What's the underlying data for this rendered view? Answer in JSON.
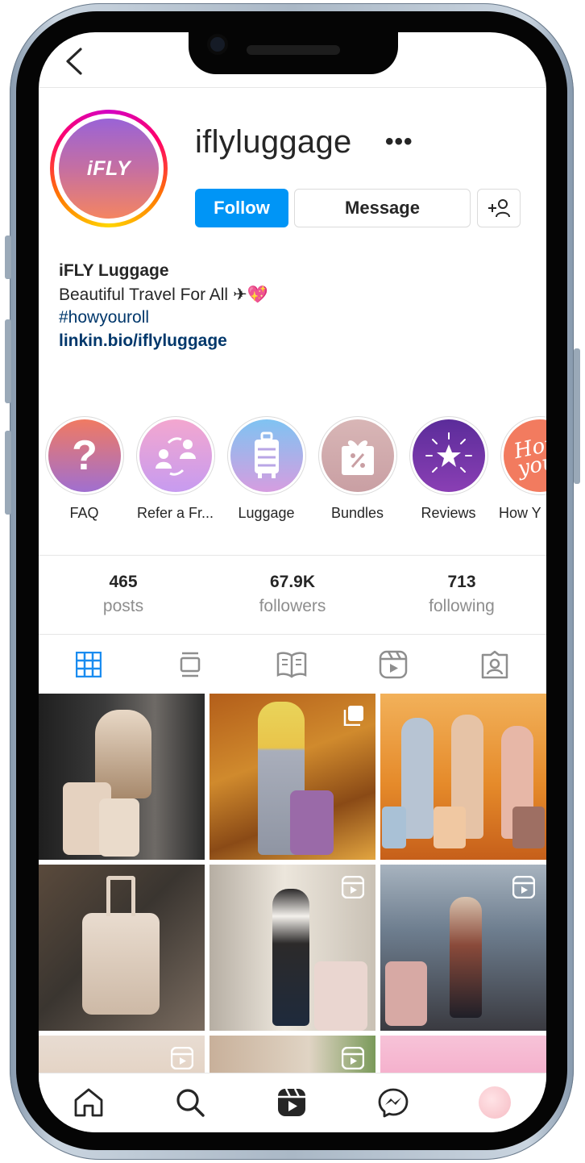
{
  "profile": {
    "username": "iflyluggage",
    "avatar_text": "iFLY",
    "more_label": "•••",
    "follow_label": "Follow",
    "message_label": "Message"
  },
  "bio": {
    "name": "iFLY Luggage",
    "line": "Beautiful Travel For All",
    "emoji": "✈💖",
    "hashtag": "#howyouroll",
    "link": "linkin.bio/iflyluggage"
  },
  "highlights": [
    {
      "label": "FAQ",
      "icon": "question-icon"
    },
    {
      "label": "Refer a Fr...",
      "icon": "refer-icon"
    },
    {
      "label": "Luggage",
      "icon": "suitcase-icon"
    },
    {
      "label": "Bundles",
      "icon": "gift-icon"
    },
    {
      "label": "Reviews",
      "icon": "star-icon"
    },
    {
      "label": "How Y",
      "icon": "script-text-icon"
    }
  ],
  "stats": {
    "posts_count": "465",
    "posts_label": "posts",
    "followers_count": "67.9K",
    "followers_label": "followers",
    "following_count": "713",
    "following_label": "following"
  },
  "tabs": [
    "grid-icon",
    "feed-icon",
    "guide-icon",
    "reels-icon",
    "tagged-icon"
  ],
  "grid": [
    {
      "kind": "photo",
      "badge": "none",
      "colors": [
        "#2b2b2b",
        "#6e6a66",
        "#e5d2c0"
      ]
    },
    {
      "kind": "photo",
      "badge": "carousel-icon",
      "colors": [
        "#c57a24",
        "#8a4a16",
        "#e9c44a"
      ]
    },
    {
      "kind": "photo",
      "badge": "none",
      "colors": [
        "#e58a2a",
        "#f2b15a",
        "#b7c4d3"
      ]
    },
    {
      "kind": "photo",
      "badge": "none",
      "colors": [
        "#3a3530",
        "#7a6c60",
        "#d8c7b8"
      ]
    },
    {
      "kind": "photo",
      "badge": "reels-icon",
      "colors": [
        "#c9c1b5",
        "#ece6dc",
        "#2c2a2a"
      ]
    },
    {
      "kind": "photo",
      "badge": "reels-icon",
      "colors": [
        "#6d7d8e",
        "#a7b3bf",
        "#3a3a40"
      ]
    },
    {
      "kind": "photo",
      "badge": "reels-icon",
      "colors": [
        "#e8dcd2",
        "#d7b89a",
        "#ffffff"
      ]
    },
    {
      "kind": "photo",
      "badge": "reels-icon",
      "colors": [
        "#c8b09a",
        "#e0d4c4",
        "#7a9a5a"
      ]
    },
    {
      "kind": "photo",
      "badge": "none",
      "colors": [
        "#f29bbf",
        "#f7c3d8",
        "#d86d9c"
      ]
    }
  ],
  "nav": [
    "home-icon",
    "search-icon",
    "reels-icon",
    "messenger-icon",
    "profile-avatar"
  ],
  "colors": {
    "accent": "#0095f6",
    "link": "#00376b",
    "text": "#262626",
    "muted": "#8e8e8e"
  }
}
